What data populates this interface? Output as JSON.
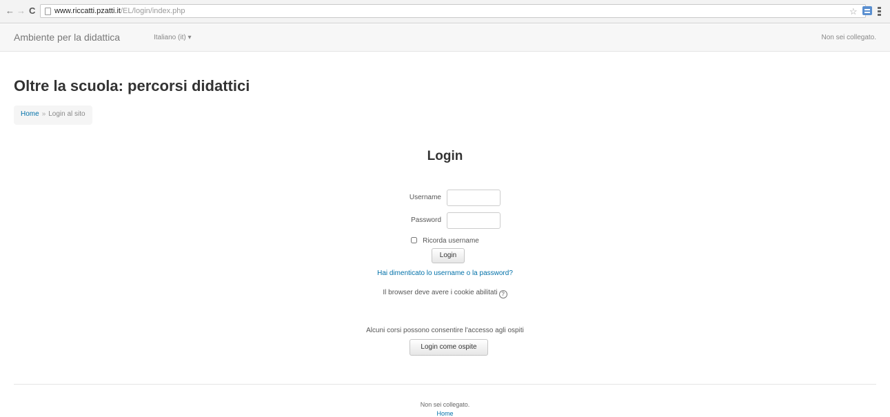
{
  "browser": {
    "back_glyph": "←",
    "forward_glyph": "→",
    "reload_glyph": "C",
    "url_host": "www.riccatti.pzatti.it",
    "url_path": "/EL/login/index.php",
    "star_glyph": "☆",
    "icons": [
      "back-icon",
      "forward-icon",
      "reload-icon",
      "page-icon",
      "bookmark-star-icon",
      "extension-icon",
      "menu-icon"
    ]
  },
  "navbar": {
    "brand": "Ambiente per la didattica",
    "language": "Italiano (it) ▾",
    "login_info": "Non sei collegato."
  },
  "page": {
    "title": "Oltre la scuola: percorsi didattici"
  },
  "breadcrumb": {
    "home": "Home",
    "separator": "»",
    "current": "Login al sito"
  },
  "login": {
    "heading": "Login",
    "username_label": "Username",
    "username_value": "",
    "password_label": "Password",
    "password_value": "",
    "remember_label": "Ricorda username",
    "login_button": "Login",
    "forgot_link": "Hai dimenticato lo username o la password?",
    "cookies_notice": "Il browser deve avere i cookie abilitati",
    "help_glyph": "?",
    "guest_notice": "Alcuni corsi possono consentire l'accesso agli ospiti",
    "guest_button": "Login come ospite"
  },
  "footer": {
    "login_info": "Non sei collegato.",
    "home_link": "Home"
  },
  "colors": {
    "link": "#0070a8",
    "text": "#333333",
    "navbar_bg": "#f7f7f7"
  }
}
